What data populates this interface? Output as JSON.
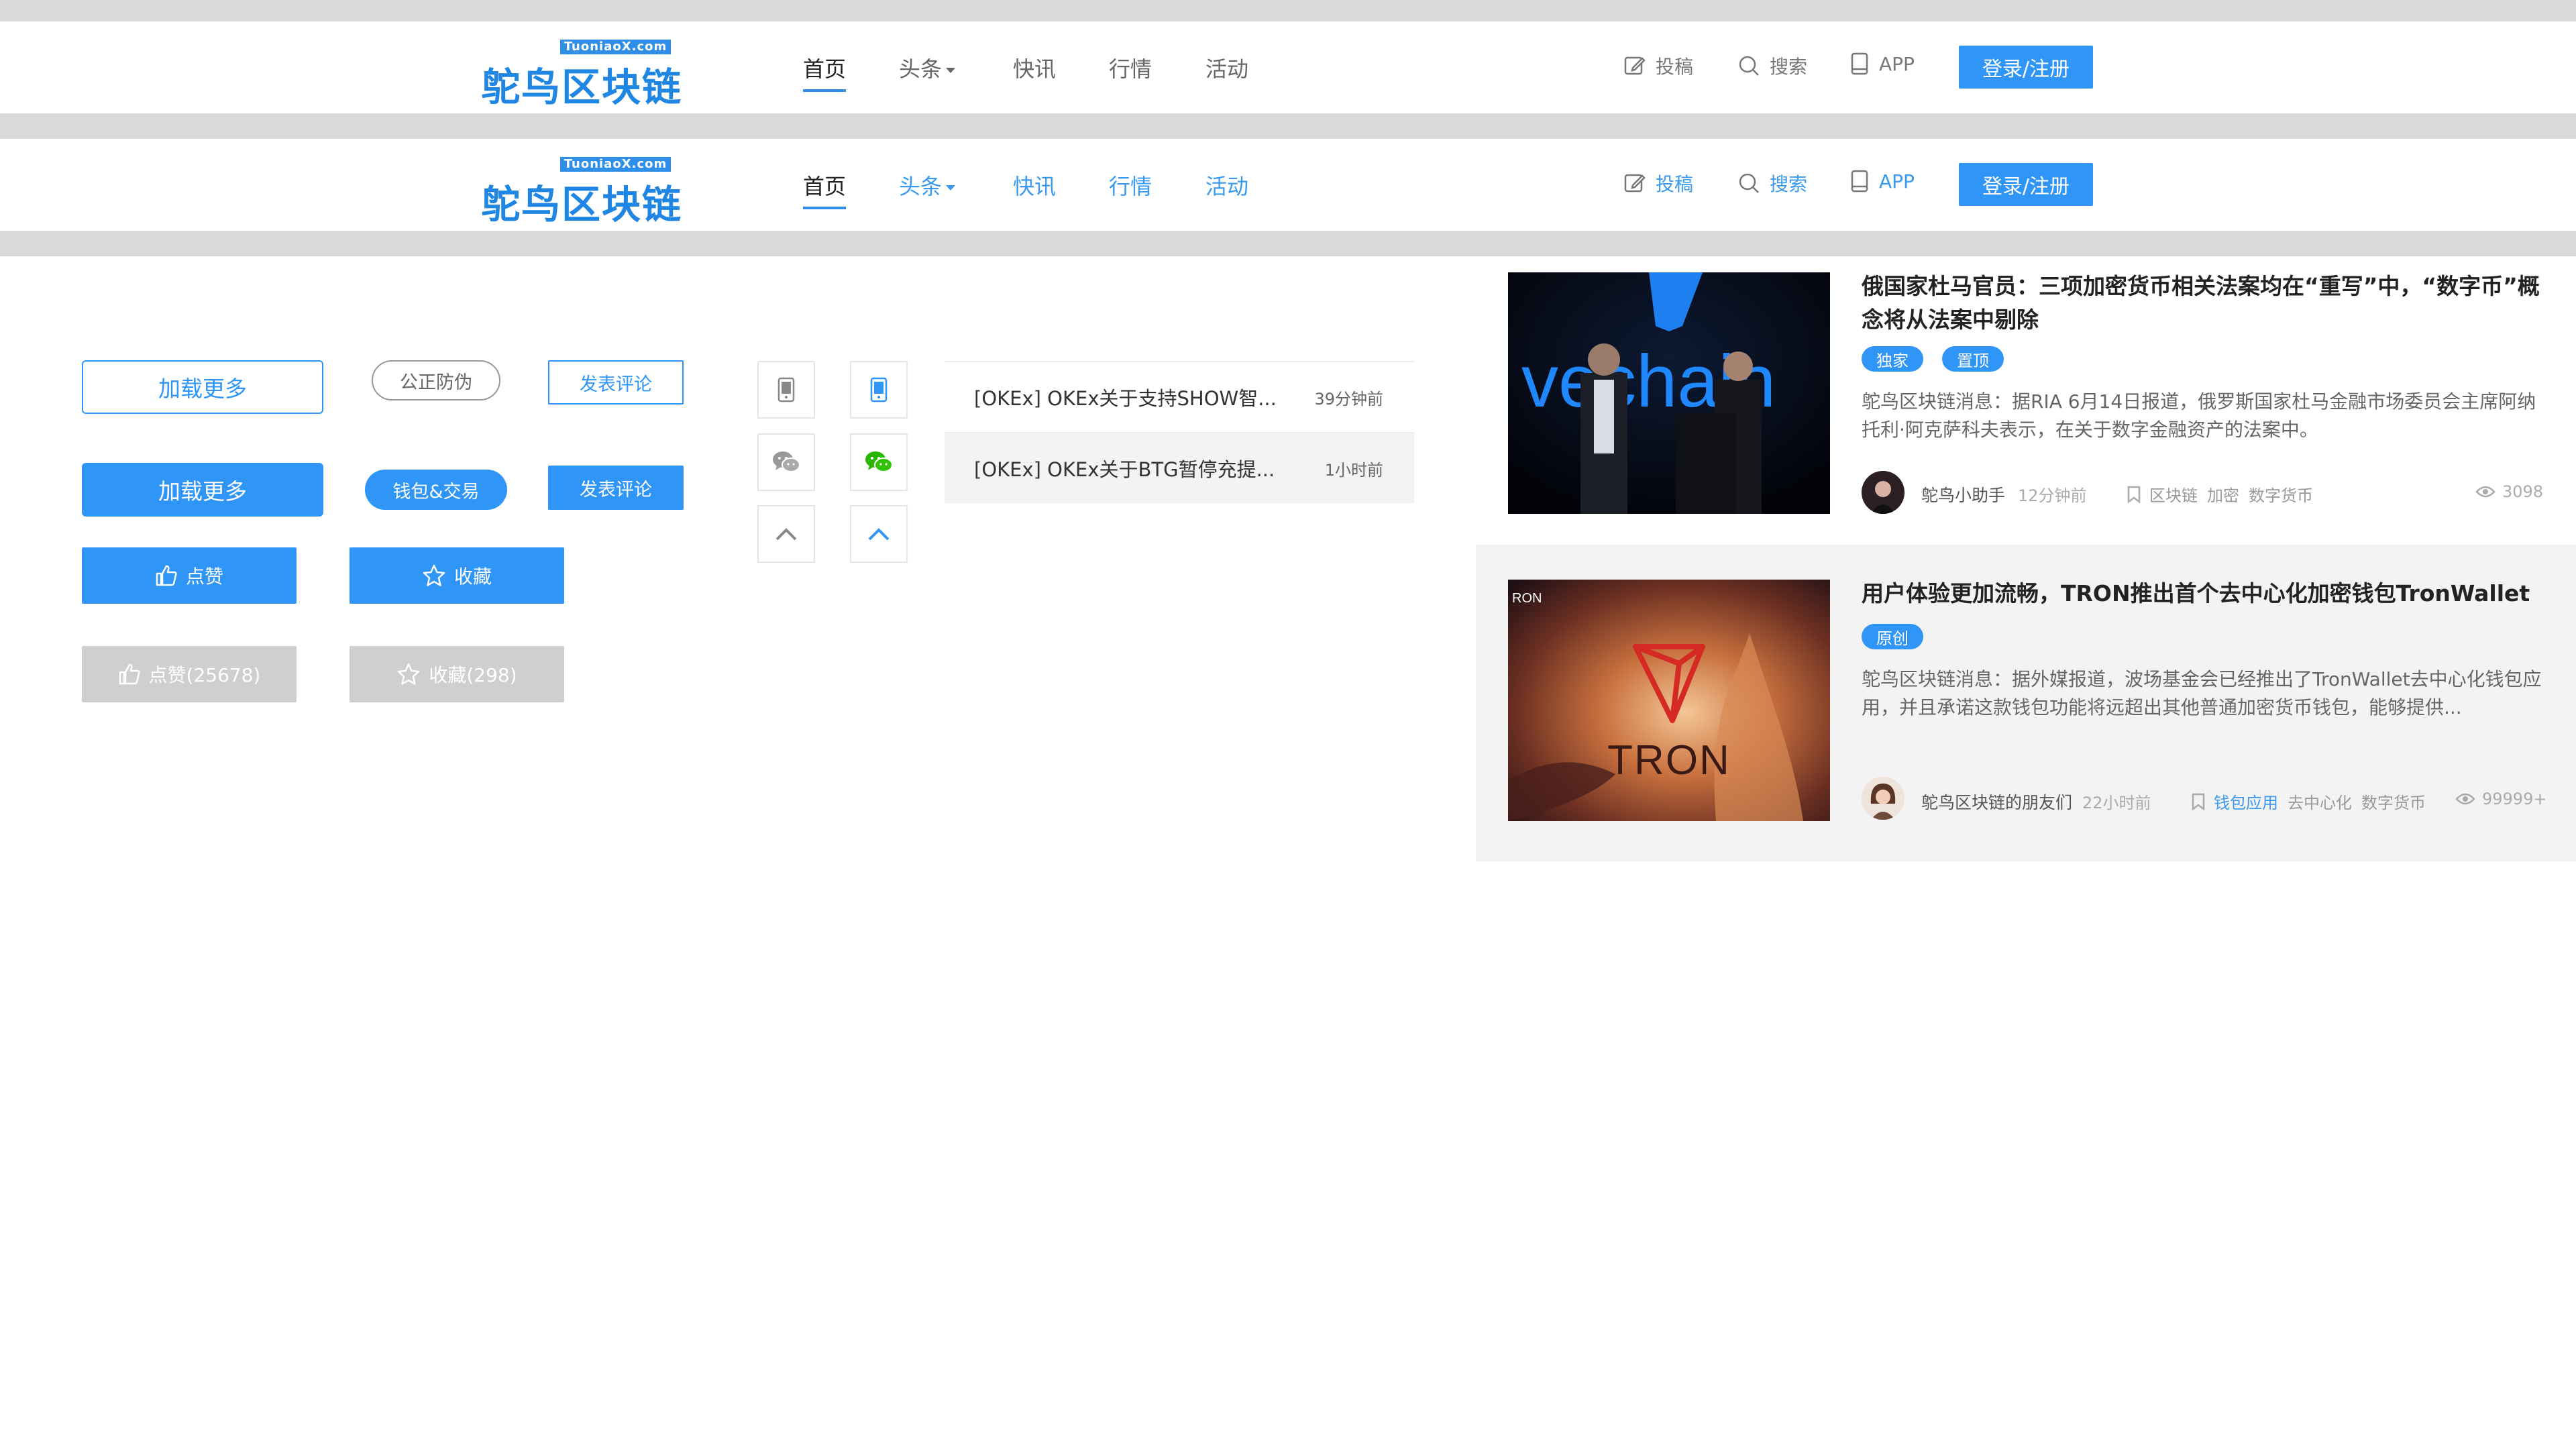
{
  "navbar": {
    "logo_badge": "TuoniaoX.com",
    "logo_text": "鸵鸟区块链",
    "items": [
      {
        "label": "首页"
      },
      {
        "label": "头条"
      },
      {
        "label": "快讯"
      },
      {
        "label": "行情"
      },
      {
        "label": "活动"
      }
    ],
    "tools": {
      "submit": "投稿",
      "search": "搜索",
      "app": "APP"
    },
    "login": "登录/注册"
  },
  "buttons": {
    "load_more": "加载更多",
    "fair_anti": "公正防伪",
    "comment": "发表评论",
    "load_more_solid": "加载更多",
    "wallet_trade": "钱包&交易",
    "comment_solid": "发表评论",
    "like": "点赞",
    "favorite": "收藏",
    "like_count": "点赞(25678)",
    "favorite_count": "收藏(298)"
  },
  "news_list": [
    {
      "title": "[OKEx] OKEx关于支持SHOW智...",
      "time": "39分钟前"
    },
    {
      "title": "[OKEx] OKEx关于BTG暂停充提...",
      "time": "1小时前"
    }
  ],
  "articles": [
    {
      "title": "俄国家杜马官员：三项加密货币相关法案均在“重写”中，“数字币”概念将从法案中剔除",
      "tags": [
        "独家",
        "置顶"
      ],
      "desc": "鸵鸟区块链消息：据RIA 6月14日报道，俄罗斯国家杜马金融市场委员会主席阿纳托利·阿克萨科夫表示，在关于数字金融资产的法案中。",
      "author": "鸵鸟小助手",
      "time": "12分钟前",
      "keywords": [
        "区块链",
        "加密",
        "数字货币"
      ],
      "views": "3098",
      "image_text": "vechain"
    },
    {
      "title": "用户体验更加流畅，TRON推出首个去中心化加密钱包TronWallet",
      "tags": [
        "原创"
      ],
      "desc": "鸵鸟区块链消息：据外媒报道，波场基金会已经推出了TronWallet去中心化钱包应用，并且承诺这款钱包功能将远超出其他普通加密货币钱包，能够提供...",
      "author": "鸵鸟区块链的朋友们",
      "time": "22小时前",
      "keywords": [
        "钱包应用",
        "去中心化",
        "数字货币"
      ],
      "views": "99999+",
      "image_text": "TRON",
      "image_corner": "RON"
    }
  ],
  "colors": {
    "accent": "#2f95f7",
    "band": "#d9d9d9",
    "hover_bg": "#f3f3f3",
    "wechat_green": "#29b500"
  }
}
